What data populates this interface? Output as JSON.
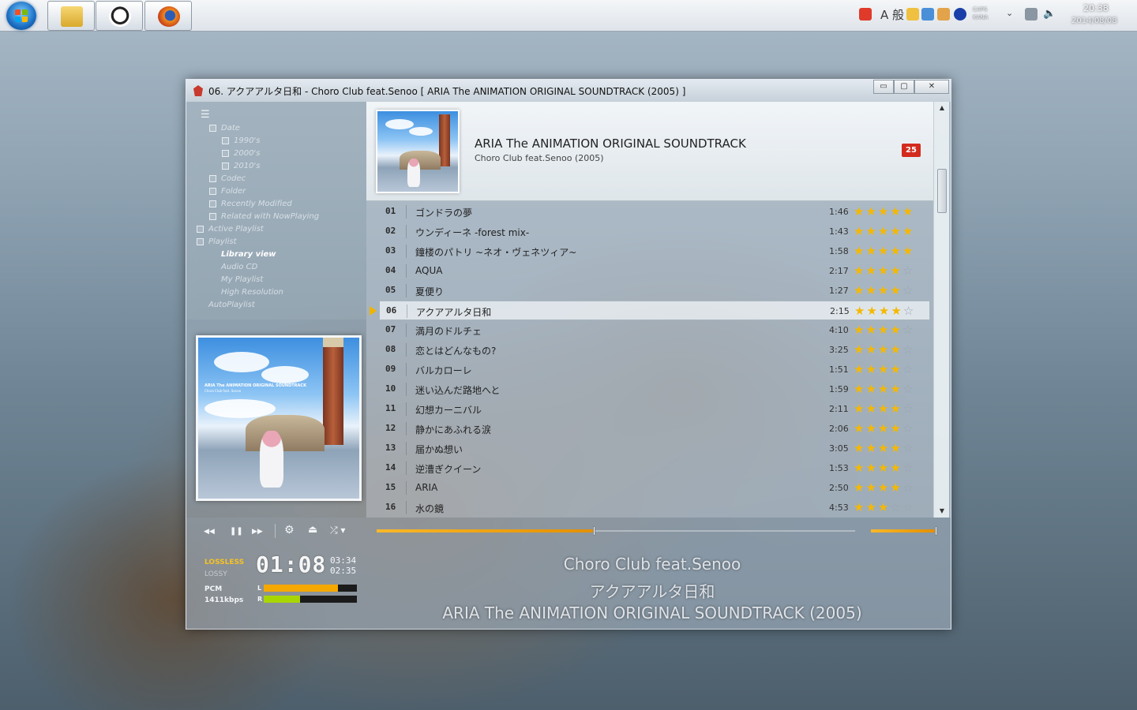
{
  "taskbar": {
    "clock_time": "20:38",
    "clock_date": "2014/08/08",
    "ime_text": "A 般",
    "caps_text": "CAPS",
    "kana_text": "KANA"
  },
  "window": {
    "title": "06. アクアアルタ日和 - Choro Club feat.Senoo [ ARIA The ANIMATION ORIGINAL SOUNDTRACK (2005) ]",
    "min_label": "▭",
    "max_label": "▢",
    "close_label": "✕"
  },
  "tree": {
    "menu_icon": "☰",
    "items": [
      {
        "label": "Date"
      },
      {
        "label": "1990's"
      },
      {
        "label": "2000's"
      },
      {
        "label": "2010's"
      },
      {
        "label": "Codec"
      },
      {
        "label": "Folder"
      },
      {
        "label": "Recently Modified"
      },
      {
        "label": "Related with NowPlaying"
      },
      {
        "label": "Active Playlist"
      },
      {
        "label": "Playlist"
      },
      {
        "label": "Library view"
      },
      {
        "label": "Audio CD"
      },
      {
        "label": "My Playlist"
      },
      {
        "label": "High Resolution"
      },
      {
        "label": "AutoPlaylist"
      }
    ]
  },
  "album": {
    "title": "ARIA The ANIMATION ORIGINAL SOUNDTRACK",
    "subtitle": "Choro Club feat.Senoo (2005)",
    "track_count": "25",
    "art_text": "ARIA The ANIMATION ORIGINAL SOUNDTRACK",
    "art_artist": "Choro Club feat. Senoo"
  },
  "tracks": [
    {
      "num": "01",
      "title": "ゴンドラの夢",
      "duration": "1:46",
      "rating": 5
    },
    {
      "num": "02",
      "title": "ウンディーネ -forest mix-",
      "duration": "1:43",
      "rating": 5
    },
    {
      "num": "03",
      "title": "鐘楼のパトリ ~ネオ・ヴェネツィア~",
      "duration": "1:58",
      "rating": 5
    },
    {
      "num": "04",
      "title": "AQUA",
      "duration": "2:17",
      "rating": 4
    },
    {
      "num": "05",
      "title": "夏便り",
      "duration": "1:27",
      "rating": 4
    },
    {
      "num": "06",
      "title": "アクアアルタ日和",
      "duration": "2:15",
      "rating": 4,
      "playing": true
    },
    {
      "num": "07",
      "title": "満月のドルチェ",
      "duration": "4:10",
      "rating": 4
    },
    {
      "num": "08",
      "title": "恋とはどんなもの?",
      "duration": "3:25",
      "rating": 4
    },
    {
      "num": "09",
      "title": "バルカローレ",
      "duration": "1:51",
      "rating": 4
    },
    {
      "num": "10",
      "title": "迷い込んだ路地へと",
      "duration": "1:59",
      "rating": 4
    },
    {
      "num": "11",
      "title": "幻想カーニバル",
      "duration": "2:11",
      "rating": 4
    },
    {
      "num": "12",
      "title": "静かにあふれる涙",
      "duration": "2:06",
      "rating": 4
    },
    {
      "num": "13",
      "title": "届かぬ想い",
      "duration": "3:05",
      "rating": 4
    },
    {
      "num": "14",
      "title": "逆漕ぎクイーン",
      "duration": "1:53",
      "rating": 4
    },
    {
      "num": "15",
      "title": "ARIA",
      "duration": "2:50",
      "rating": 4
    },
    {
      "num": "16",
      "title": "水の鏡",
      "duration": "4:53",
      "rating": 3
    }
  ],
  "transport": {
    "prev_icon": "◀◀",
    "pause_icon": "❚❚",
    "next_icon": "▶▶",
    "settings_icon": "⚙",
    "eject_icon": "⏏",
    "shuffle_icon": "⤮ ▾",
    "seek_progress": 0.455,
    "volume_level": 1.0
  },
  "status": {
    "lossless": "LOSSLESS",
    "lossy": "LOSSY",
    "pcm": "PCM",
    "bitrate": "1411kbps",
    "elapsed": "01:08",
    "total": "03:34",
    "remaining": "02:35",
    "vu_left_label": "L",
    "vu_right_label": "R",
    "vu_left_level": 0.8,
    "vu_right_level": 0.39
  },
  "now_playing": {
    "artist": "Choro Club feat.Senoo",
    "title": "アクアアルタ日和",
    "album": "ARIA The ANIMATION ORIGINAL SOUNDTRACK (2005)"
  },
  "colors": {
    "accent": "#f5b800",
    "badge": "#d32a1e",
    "vu_left": "#f5a800",
    "vu_right": "#a8d600"
  }
}
